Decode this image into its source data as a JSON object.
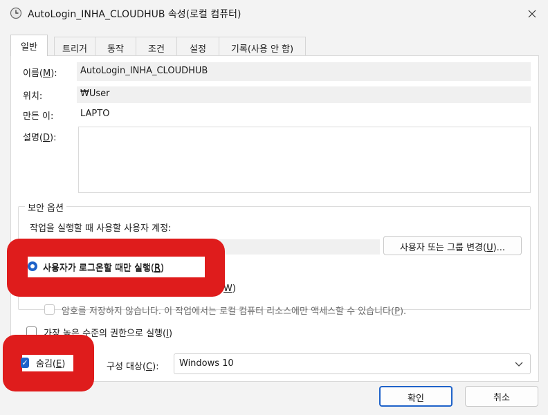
{
  "window": {
    "title": "AutoLogin_INHA_CLOUDHUB 속성(로컬 컴퓨터)",
    "icon": "clock-icon",
    "close_icon": "close-icon"
  },
  "tabs": [
    {
      "label": "일반",
      "active": true
    },
    {
      "label": "트리거",
      "active": false
    },
    {
      "label": "동작",
      "active": false
    },
    {
      "label": "조건",
      "active": false
    },
    {
      "label": "설정",
      "active": false
    },
    {
      "label": "기록(사용 안 함)",
      "active": false
    }
  ],
  "general": {
    "name_label_pre": "이름(",
    "name_label_key": "M",
    "name_label_post": "):",
    "name_value": "AutoLogin_INHA_CLOUDHUB",
    "location_label": "위치:",
    "location_value": "₩User",
    "author_label": "만든 이:",
    "author_value": "LAPTO",
    "description_label_pre": "설명(",
    "description_label_key": "D",
    "description_label_post": "):",
    "description_value": ""
  },
  "security": {
    "title": "보안 옵션",
    "account_prompt": "작업을 실행할 때 사용할 사용자 계정:",
    "change_button_pre": "사용자 또는 그룹 변경(",
    "change_button_key": "U",
    "change_button_post": ")...",
    "radio_logged_on_pre": "사용자가 로그온할 때만 실행(",
    "radio_logged_on_key": "R",
    "radio_logged_on_post": ")",
    "radio_whether_key": "W",
    "radio_whether_post": ")",
    "no_store_password_pre": "암호를 저장하지 않습니다. 이 작업에서는 로컬 컴퓨터 리소스에만 액세스할 수 있습니다(",
    "no_store_password_key": "P",
    "no_store_password_post": ").",
    "highest_privileges_pre": "가장 높은 수준의 권한으로 실행(",
    "highest_privileges_key": "I",
    "highest_privileges_post": ")"
  },
  "bottom": {
    "hidden_pre": "숨김(",
    "hidden_key": "E",
    "hidden_post": ")",
    "configure_label_pre": "구성 대상(",
    "configure_label_key": "C",
    "configure_label_post": "):",
    "configure_value": "Windows 10"
  },
  "buttons": {
    "ok": "확인",
    "cancel": "취소"
  },
  "colors": {
    "accent": "#1e62c9",
    "redaction": "#df1c1c"
  }
}
